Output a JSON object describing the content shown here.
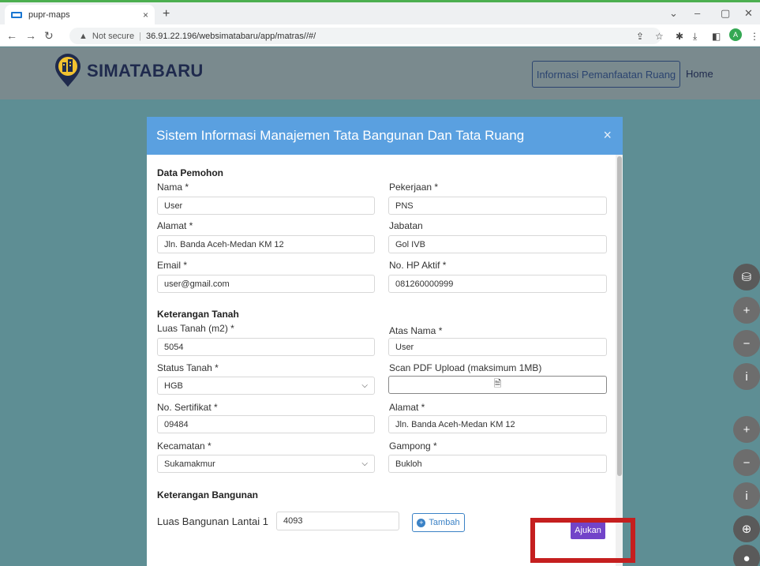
{
  "browser": {
    "tab_title": "pupr-maps",
    "tab_close": "×",
    "new_tab": "+",
    "not_secure": "Not secure",
    "url": "36.91.22.196/websimatabaru/app/matras//#/",
    "profile_initial": "A"
  },
  "header": {
    "brand": "SIMATABARU",
    "nav_button": "Informasi Pemanfaatan Ruang",
    "home_link": "Home"
  },
  "modal": {
    "title": "Sistem Informasi Manajemen Tata Bangunan Dan Tata Ruang",
    "close": "×",
    "pemohon": {
      "section": "Data Pemohon",
      "nama_label": "Nama *",
      "nama_value": "User",
      "pekerjaan_label": "Pekerjaan *",
      "pekerjaan_value": "PNS",
      "alamat_label": "Alamat *",
      "alamat_value": "Jln. Banda Aceh-Medan KM 12",
      "jabatan_label": "Jabatan",
      "jabatan_value": "Gol IVB",
      "email_label": "Email *",
      "email_value": "user@gmail.com",
      "hp_label": "No. HP Aktif *",
      "hp_value": "081260000999"
    },
    "tanah": {
      "section": "Keterangan Tanah",
      "luas_label": "Luas Tanah (m2) *",
      "luas_value": "5054",
      "atasnama_label": "Atas Nama *",
      "atasnama_value": "User",
      "status_label": "Status Tanah *",
      "status_value": "HGB",
      "scan_label": "Scan PDF Upload (maksimum 1MB)",
      "sertifikat_label": "No. Sertifikat *",
      "sertifikat_value": "09484",
      "alamat_label": "Alamat *",
      "alamat_value": "Jln. Banda Aceh-Medan KM 12",
      "kecamatan_label": "Kecamatan *",
      "kecamatan_value": "Sukamakmur",
      "gampong_label": "Gampong *",
      "gampong_value": "Bukloh"
    },
    "bangunan": {
      "section": "Keterangan Bangunan",
      "luas_label": "Luas Bangunan Lantai 1",
      "luas_value": "4093",
      "tambah": "Tambah"
    },
    "submit": "Ajukan"
  },
  "colors": {
    "modal_header": "#5aa0e0",
    "submit": "#7244c9",
    "highlight": "#c51f1f"
  }
}
